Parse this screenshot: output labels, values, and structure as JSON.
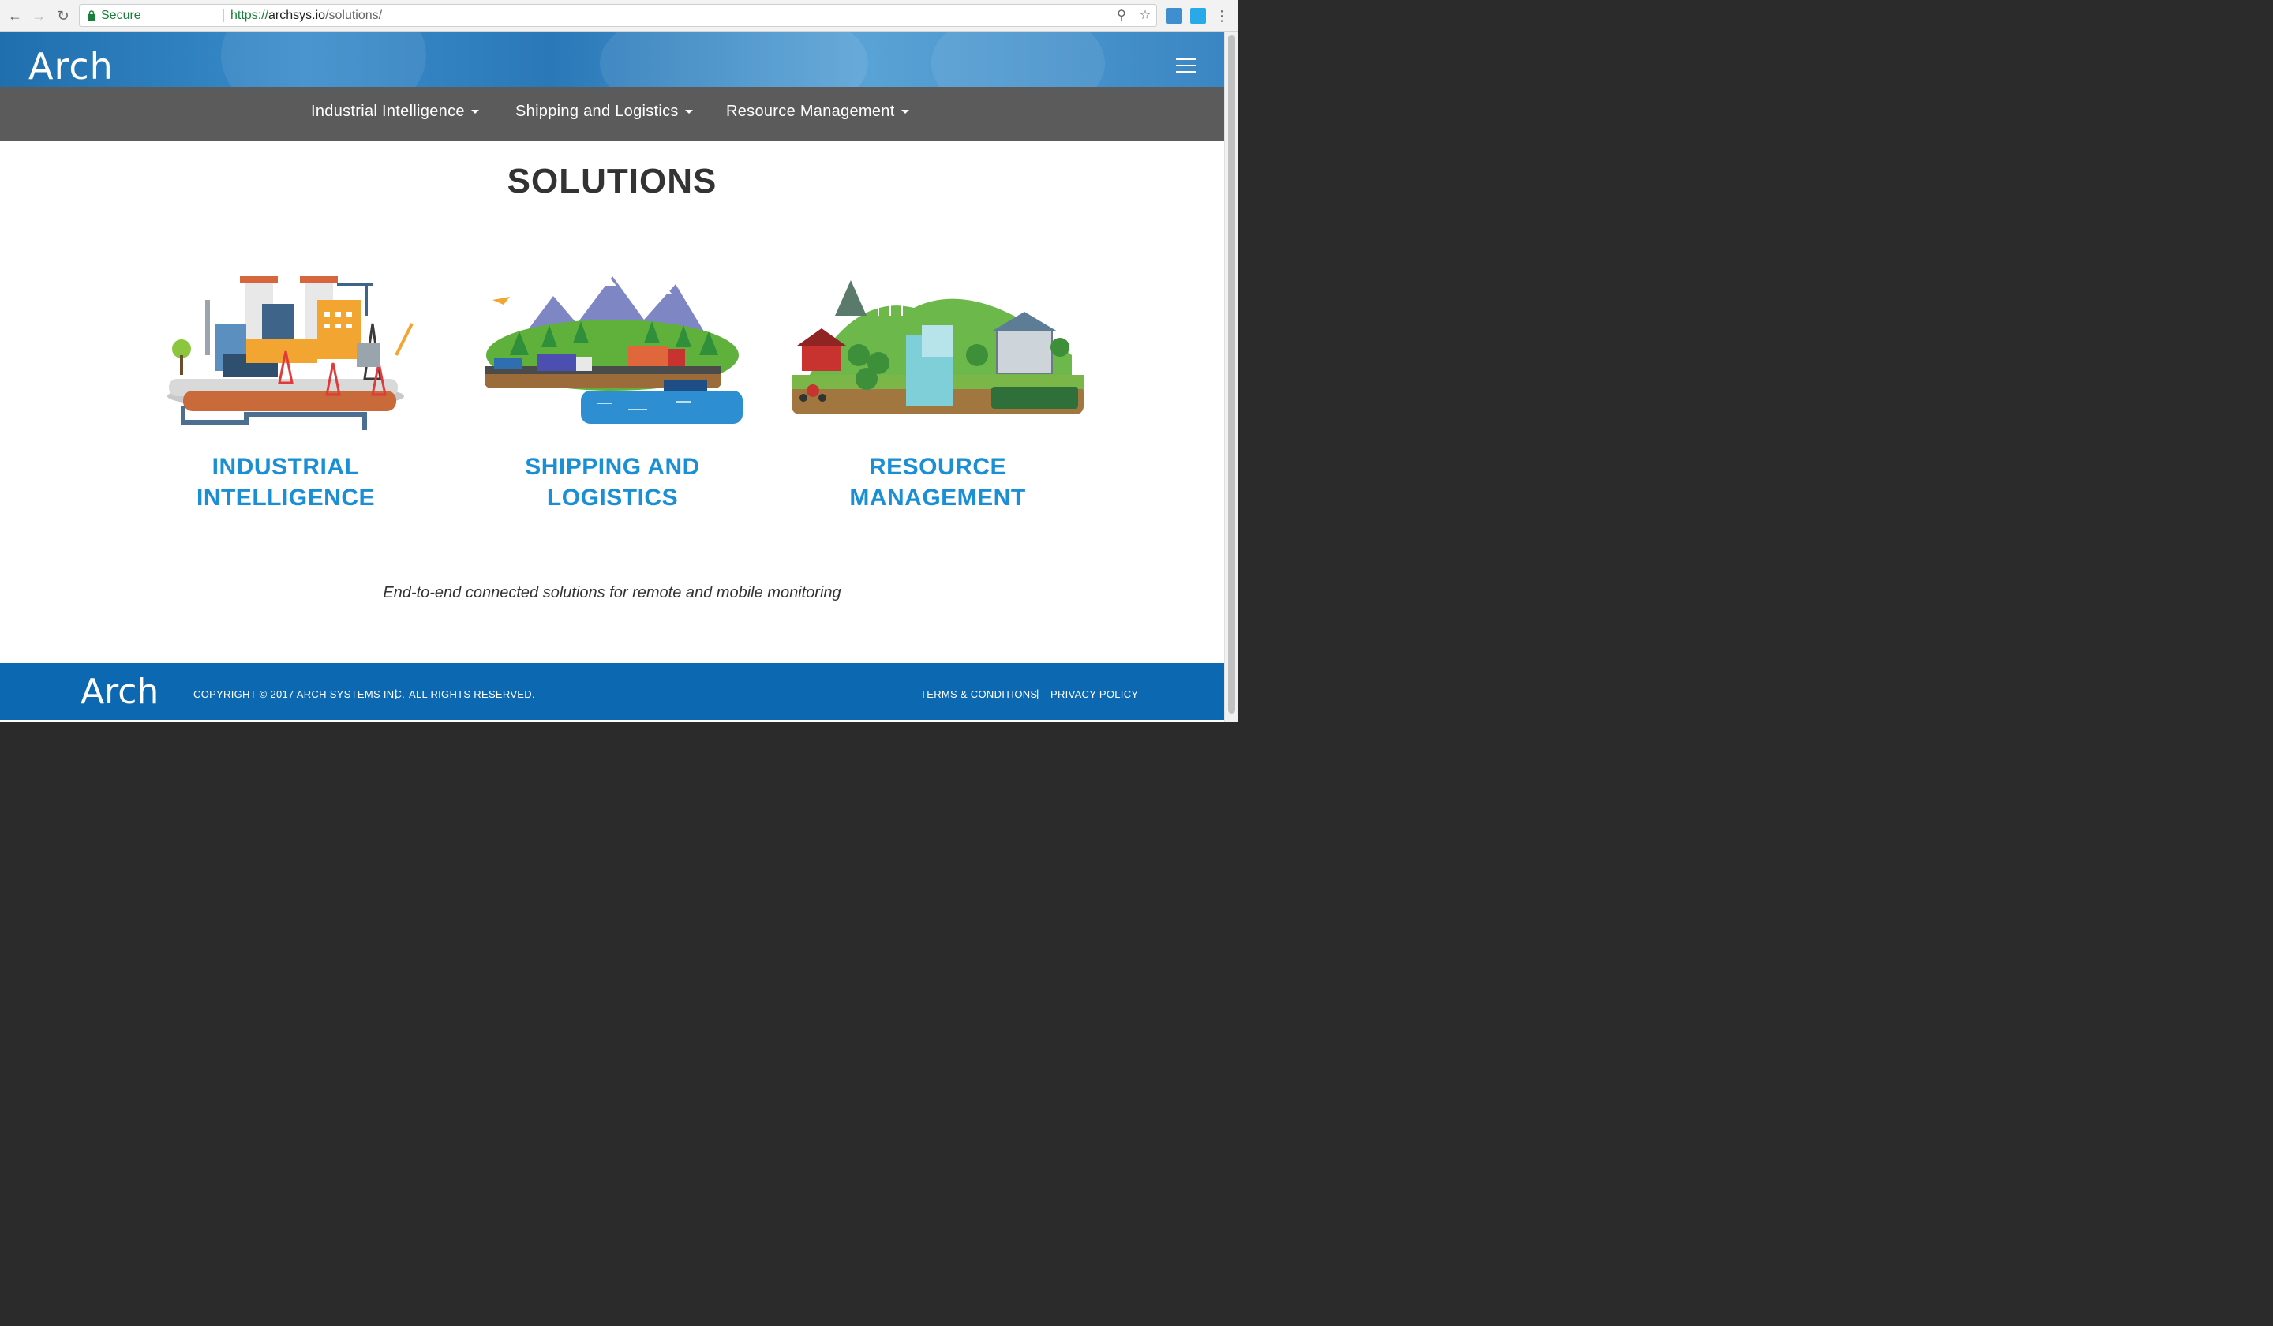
{
  "browser": {
    "secure_label": "Secure",
    "url_scheme": "https://",
    "url_host": "archsys.io",
    "url_path": "/solutions/"
  },
  "header": {
    "logo_text": "Arch"
  },
  "subnav": {
    "items": [
      {
        "label": "Industrial Intelligence"
      },
      {
        "label": "Shipping and Logistics"
      },
      {
        "label": "Resource Management"
      }
    ]
  },
  "main": {
    "title": "SOLUTIONS",
    "cards": [
      {
        "line1": "INDUSTRIAL",
        "line2": "INTELLIGENCE"
      },
      {
        "line1": "SHIPPING AND",
        "line2": "LOGISTICS"
      },
      {
        "line1": "RESOURCE",
        "line2": "MANAGEMENT"
      }
    ],
    "tagline": "End-to-end connected solutions for remote and mobile monitoring"
  },
  "footer": {
    "logo_text": "Arch",
    "copyright": "COPYRIGHT © 2017 ARCH SYSTEMS INC.",
    "rights": "ALL RIGHTS RESERVED.",
    "separator": "|",
    "terms": "TERMS & CONDITIONS",
    "privacy": "PRIVACY POLICY"
  },
  "colors": {
    "accent": "#1b8fd6",
    "footer_bg": "#0d68b2",
    "subnav_bg": "#5b5b5b"
  }
}
